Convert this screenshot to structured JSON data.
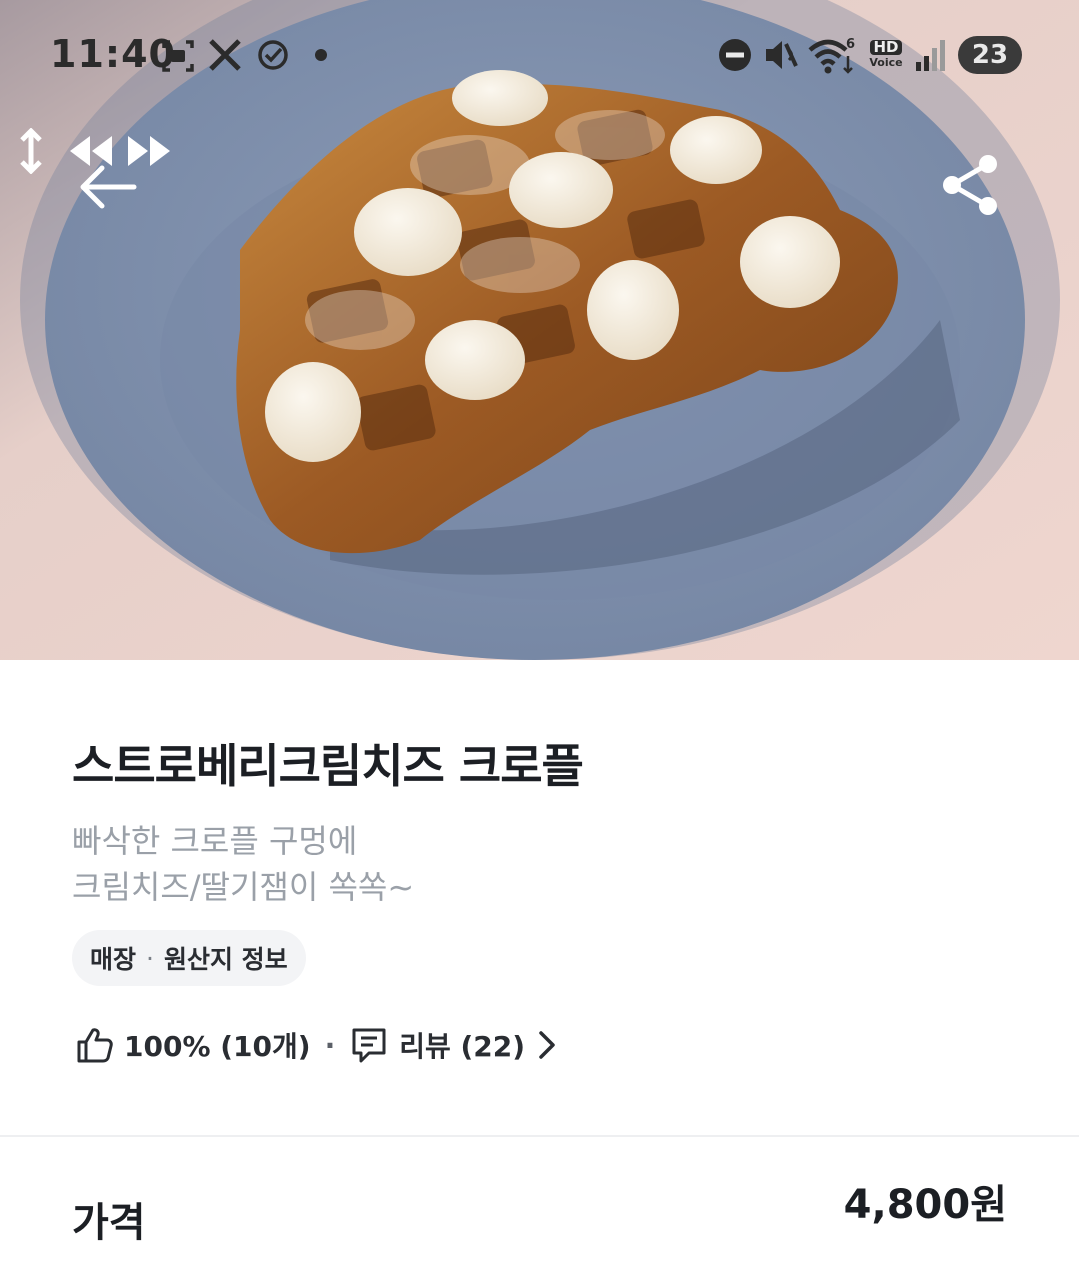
{
  "status_bar": {
    "time": "11:40",
    "battery": "23",
    "hd_label": "HD",
    "voice_label": "Voice",
    "wifi_badge": "6",
    "left_icons": [
      "screenshot-icon",
      "x-logo-icon",
      "check-circle-icon",
      "dot-icon"
    ],
    "right_icons": [
      "do-not-disturb-icon",
      "mute-icon",
      "wifi-icon",
      "hd-voice-icon",
      "signal-icon",
      "battery-icon"
    ]
  },
  "hero": {
    "photo": "strawberry cream cheese croffle on blue plate",
    "colors": {
      "plate": "#7f90ad",
      "table": "#e8d2cc",
      "waffle": "#a8662a",
      "cream": "#f3ecdf"
    }
  },
  "nav": {
    "icons": [
      "resize-vertical-icon",
      "rewind-icon",
      "fast-forward-icon",
      "back-arrow-icon",
      "share-icon"
    ]
  },
  "product": {
    "title": "스트로베리크림치즈 크로플",
    "description_line1": "빠삭한 크로플 구멍에",
    "description_line2": "크림치즈/딸기잼이 쏙쏙~",
    "chip_left": "매장",
    "chip_sep": "·",
    "chip_right": "원산지 정보",
    "rating": "100% (10개)",
    "meta_sep": "·",
    "reviews": "리뷰 (22)"
  },
  "price": {
    "label": "가격",
    "value": "4,800원"
  },
  "colors": {
    "text_primary": "#1c1f24",
    "text_secondary": "#9aa0a8",
    "chip_bg": "#f3f4f6",
    "divider": "#eeeff1"
  }
}
